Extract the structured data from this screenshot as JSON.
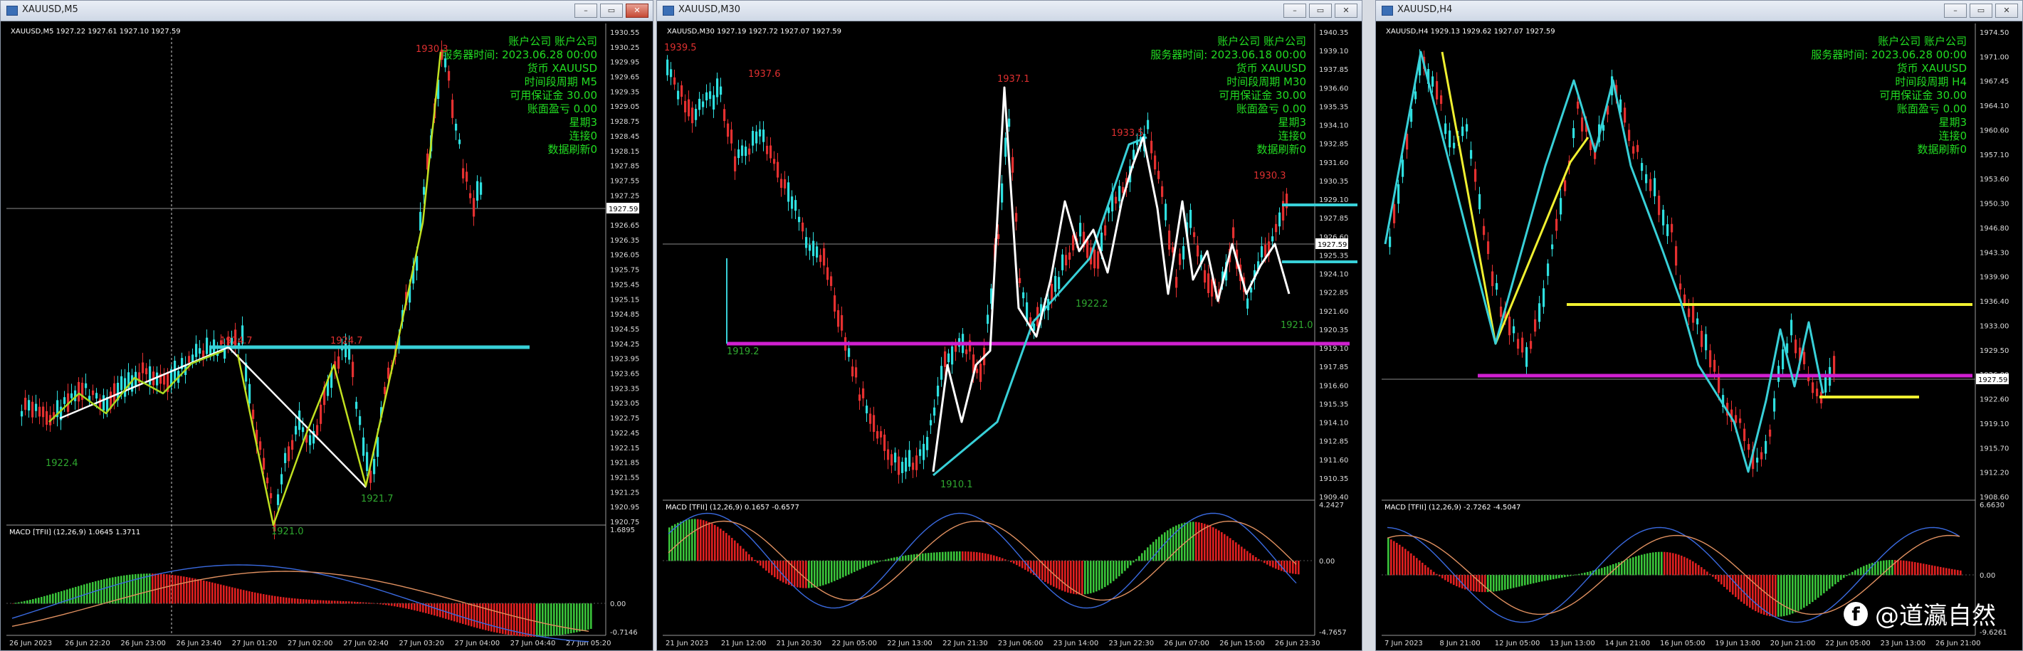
{
  "windows": [
    {
      "title": "XAUUSD,M5",
      "header": "XAUUSD,M5  1927.22 1927.61 1927.10 1927.59",
      "current_price_tag": "1927.59",
      "info_lines": [
        "账户公司 账户公司",
        "服务器时间: 2023.06.28 00:00",
        "货币 XAUUSD",
        "时间段周期 M5",
        "可用保证金 30.00",
        "账面盈亏 0.00",
        "星期3",
        "连接0",
        "数据刷新0"
      ],
      "price_labels": [
        "1930.55",
        "1930.25",
        "1929.95",
        "1929.65",
        "1929.35",
        "1929.05",
        "1928.75",
        "1928.45",
        "1928.15",
        "1927.85",
        "1927.55",
        "1927.25",
        "1926.95",
        "1926.65",
        "1926.35",
        "1926.05",
        "1925.75",
        "1925.45",
        "1925.15",
        "1924.85",
        "1924.55",
        "1924.25",
        "1923.95",
        "1923.65",
        "1923.35",
        "1923.05",
        "1922.75",
        "1922.45",
        "1922.15",
        "1921.85",
        "1921.55",
        "1921.25",
        "1920.95",
        "1920.75"
      ],
      "chart_annotations": [
        {
          "text": "1930.3",
          "color": "#e03030"
        },
        {
          "text": "1924.7",
          "color": "#e03030"
        },
        {
          "text": "1924.7",
          "color": "#e03030"
        },
        {
          "text": "1921.0",
          "color": "#2fa82f"
        },
        {
          "text": "1921.7",
          "color": "#2fa82f"
        },
        {
          "text": "1922.4",
          "color": "#2fa82f"
        }
      ],
      "macd_label": "MACD [TFII] (12,26,9) 1.0645 1.3711",
      "macd_axis": [
        "1.6895",
        "0.00",
        "-0.7146"
      ],
      "time_labels": [
        "26 Jun 2023",
        "26 Jun 22:20",
        "26 Jun 23:00",
        "26 Jun 23:40",
        "27 Jun 01:20",
        "27 Jun 02:00",
        "27 Jun 02:40",
        "27 Jun 03:20",
        "27 Jun 04:00",
        "27 Jun 04:40",
        "27 Jun 05:20"
      ]
    },
    {
      "title": "XAUUSD,M30",
      "header": "XAUUSD,M30  1927.19 1927.72 1927.07 1927.59",
      "current_price_tag": "1927.59",
      "info_lines": [
        "账户公司 账户公司",
        "服务器时间: 2023.06.18 00:00",
        "货币 XAUUSD",
        "时间段周期 M30",
        "可用保证金 30.00",
        "账面盈亏 0.00",
        "星期3",
        "连接0",
        "数据刷新0"
      ],
      "price_labels": [
        "1940.35",
        "1939.10",
        "1937.85",
        "1936.60",
        "1935.35",
        "1934.10",
        "1932.85",
        "1931.60",
        "1930.35",
        "1929.10",
        "1927.85",
        "1926.60",
        "1925.35",
        "1924.10",
        "1922.85",
        "1921.60",
        "1920.35",
        "1919.10",
        "1917.85",
        "1916.60",
        "1915.35",
        "1914.10",
        "1912.85",
        "1911.60",
        "1910.35",
        "1909.40"
      ],
      "chart_annotations": [
        {
          "text": "1939.5",
          "color": "#e03030"
        },
        {
          "text": "1937.6",
          "color": "#e03030"
        },
        {
          "text": "1937.1",
          "color": "#e03030"
        },
        {
          "text": "1933.5",
          "color": "#e03030"
        },
        {
          "text": "1930.3",
          "color": "#e03030"
        },
        {
          "text": "1919.2",
          "color": "#2fa82f"
        },
        {
          "text": "1922.2",
          "color": "#2fa82f"
        },
        {
          "text": "1921.0",
          "color": "#2fa82f"
        },
        {
          "text": "1910.1",
          "color": "#2fa82f"
        }
      ],
      "macd_label": "MACD [TFII] (12,26,9) 0.1657 -0.6577",
      "macd_axis": [
        "4.2427",
        "0.00",
        "-4.7657"
      ],
      "time_labels": [
        "21 Jun 2023",
        "21 Jun 12:00",
        "21 Jun 20:30",
        "22 Jun 05:00",
        "22 Jun 13:00",
        "22 Jun 21:30",
        "23 Jun 06:00",
        "23 Jun 14:00",
        "23 Jun 22:30",
        "26 Jun 07:00",
        "26 Jun 15:00",
        "26 Jun 23:30"
      ]
    },
    {
      "title": "XAUUSD,H4",
      "header": "XAUUSD,H4  1929.13 1929.62 1927.07 1927.59",
      "current_price_tag": "1927.59",
      "info_lines": [
        "账户公司 账户公司",
        "服务器时间: 2023.06.28 00:00",
        "货币 XAUUSD",
        "时间段周期 H4",
        "可用保证金 30.00",
        "账面盈亏 0.00",
        "星期3",
        "连接0",
        "数据刷新0"
      ],
      "price_labels": [
        "1974.50",
        "1971.00",
        "1967.45",
        "1964.10",
        "1960.60",
        "1957.10",
        "1953.60",
        "1950.30",
        "1946.80",
        "1943.30",
        "1939.90",
        "1936.40",
        "1933.00",
        "1929.50",
        "1926.00",
        "1922.60",
        "1919.10",
        "1915.70",
        "1912.20",
        "1908.60"
      ],
      "chart_annotations": [],
      "macd_label": "MACD [TFII] (12,26,9) -2.7262 -4.5047",
      "macd_axis": [
        "6.6630",
        "0.00",
        "-9.6261"
      ],
      "time_labels": [
        "7 Jun 2023",
        "8 Jun 21:00",
        "12 Jun 05:00",
        "13 Jun 13:00",
        "14 Jun 21:00",
        "16 Jun 05:00",
        "19 Jun 13:00",
        "20 Jun 21:00",
        "22 Jun 05:00",
        "23 Jun 13:00",
        "26 Jun 21:00"
      ]
    }
  ],
  "watermark": {
    "icon": "facebook-icon",
    "text": "@道瀛自然"
  },
  "colors": {
    "up": "#2ee0e0",
    "down": "#e53030",
    "cyan": "#38d0d8",
    "magenta": "#d020d0",
    "yellow": "#f0f030",
    "green_text": "#22dd22",
    "macd_up": "#3ac43a",
    "macd_down": "#e02020"
  }
}
